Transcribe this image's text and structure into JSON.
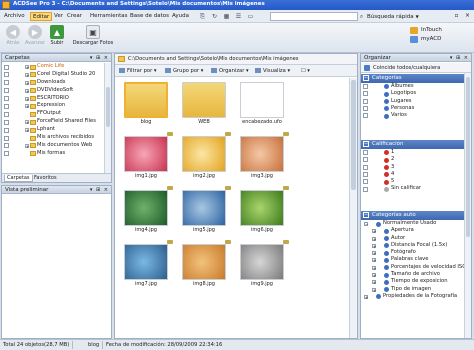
{
  "window": {
    "title": "ACDSee Pro 3 - C:\\Documents and Settings\\Sotelo\\Mis documentos\\Mis imágenes"
  },
  "menu": {
    "items": [
      "Archivo",
      "Editar",
      "Ver",
      "Crear",
      "Herramientas",
      "Base de datos",
      "Ayuda"
    ],
    "quick_search_label": "Búsqueda rápida"
  },
  "toolbar": {
    "back": "Atrás",
    "forward": "Avanzar",
    "up": "Subir",
    "download": "Descargar Fotos",
    "right_items": [
      "InTouch",
      "myACD"
    ]
  },
  "folders_panel": {
    "title": "Carpetas",
    "items": [
      {
        "label": "Comic Life",
        "link": true,
        "expand": "+"
      },
      {
        "label": "Corel Digital Studio 20",
        "link": false,
        "expand": "+"
      },
      {
        "label": "Downloads",
        "link": false,
        "expand": "+"
      },
      {
        "label": "DVDVideoSoft",
        "link": false,
        "expand": "+"
      },
      {
        "label": "ESCRITORIO",
        "link": false,
        "expand": "+"
      },
      {
        "label": "Expression",
        "link": false,
        "expand": "+"
      },
      {
        "label": "FFOutput",
        "link": false,
        "expand": ""
      },
      {
        "label": "ForceField Shared Files",
        "link": false,
        "expand": "+"
      },
      {
        "label": "Lphant",
        "link": false,
        "expand": "+"
      },
      {
        "label": "Mis archivos recibidos",
        "link": false,
        "expand": ""
      },
      {
        "label": "Mis documentos Web",
        "link": false,
        "expand": "+"
      },
      {
        "label": "Mis formas",
        "link": false,
        "expand": ""
      }
    ],
    "tabs": [
      "Carpetas",
      "Favoritos"
    ]
  },
  "preview_panel": {
    "title": "Vista preliminar"
  },
  "browser": {
    "address": "C:\\Documents and Settings\\Sotelo\\Mis documentos\\Mis imágenes",
    "filter_label": "Filtrar por",
    "group_label": "Grupo por",
    "sort_label": "Organizar",
    "view_label": "Visualiza",
    "items": [
      {
        "caption": "blog",
        "kind": "folder",
        "colors": [
          "#f4d77a",
          "#e7b73d"
        ]
      },
      {
        "caption": "WEB",
        "kind": "folder",
        "colors": [
          "#f4d77a",
          "#e7b73d"
        ]
      },
      {
        "caption": "encabezado.ufo",
        "kind": "file",
        "colors": [
          "#ffffff",
          "#e8e8e8"
        ]
      },
      {
        "caption": "img1.jpg",
        "kind": "image",
        "colors": [
          "#f6a6b6",
          "#c9324f"
        ]
      },
      {
        "caption": "img2.jpg",
        "kind": "image",
        "colors": [
          "#fbe7a6",
          "#e3a21c"
        ]
      },
      {
        "caption": "img3.jpg",
        "kind": "image",
        "colors": [
          "#f4c8a6",
          "#c8703a"
        ]
      },
      {
        "caption": "img4.jpg",
        "kind": "image",
        "colors": [
          "#6fb26a",
          "#1d5a2a"
        ]
      },
      {
        "caption": "img5.jpg",
        "kind": "image",
        "colors": [
          "#a7c8e4",
          "#2d62a0"
        ]
      },
      {
        "caption": "img6.jpg",
        "kind": "image",
        "colors": [
          "#a9d56c",
          "#3e7a1c"
        ]
      },
      {
        "caption": "img7.jpg",
        "kind": "image",
        "colors": [
          "#7bb8e6",
          "#2c5f8a"
        ]
      },
      {
        "caption": "img8.jpg",
        "kind": "image",
        "colors": [
          "#f3c27c",
          "#c87a2a"
        ]
      },
      {
        "caption": "img9.jpg",
        "kind": "image",
        "colors": [
          "#d7d7d7",
          "#7a7a7a"
        ]
      }
    ]
  },
  "organizer": {
    "title": "Organizar",
    "match_label": "Coincide todos/cualquiera",
    "categories": {
      "title": "Categorías",
      "items": [
        {
          "label": "Álbumes",
          "color": "#3f6fbc"
        },
        {
          "label": "Logotipos",
          "color": "#3f6fbc"
        },
        {
          "label": "Lugares",
          "color": "#3f6fbc"
        },
        {
          "label": "Personas",
          "color": "#3f6fbc"
        },
        {
          "label": "Varios",
          "color": "#3f6fbc"
        }
      ]
    },
    "ratings": {
      "title": "Calificación",
      "items": [
        {
          "label": "1",
          "color": "#d0302a"
        },
        {
          "label": "2",
          "color": "#d0302a"
        },
        {
          "label": "3",
          "color": "#d0302a"
        },
        {
          "label": "4",
          "color": "#d0302a"
        },
        {
          "label": "5",
          "color": "#d0302a"
        },
        {
          "label": "Sin calificar",
          "color": "#aaaaaa"
        }
      ]
    },
    "auto": {
      "title": "Categorías auto",
      "items": [
        {
          "label": "Normalmente Usado",
          "level": 0
        },
        {
          "label": "Apertura",
          "level": 1
        },
        {
          "label": "Autor",
          "level": 1
        },
        {
          "label": "Distancia Focal (1.5x)",
          "level": 1
        },
        {
          "label": "Fotógrafo",
          "level": 1
        },
        {
          "label": "Palabras clave",
          "level": 1
        },
        {
          "label": "Porcentajes de velocidad ISO",
          "level": 1
        },
        {
          "label": "Tamaño de archivo",
          "level": 1
        },
        {
          "label": "Tiempo de exposicion",
          "level": 1
        },
        {
          "label": "Tipo de imagen",
          "level": 1
        },
        {
          "label": "Propiedades de la Fotografía",
          "level": 0
        }
      ]
    }
  },
  "status": {
    "total": "Total 24 objetos",
    "size": "(28,7 MB)",
    "selected": "blog",
    "modified": "Fecha de modificación: 28/09/2009 22:34:16"
  }
}
